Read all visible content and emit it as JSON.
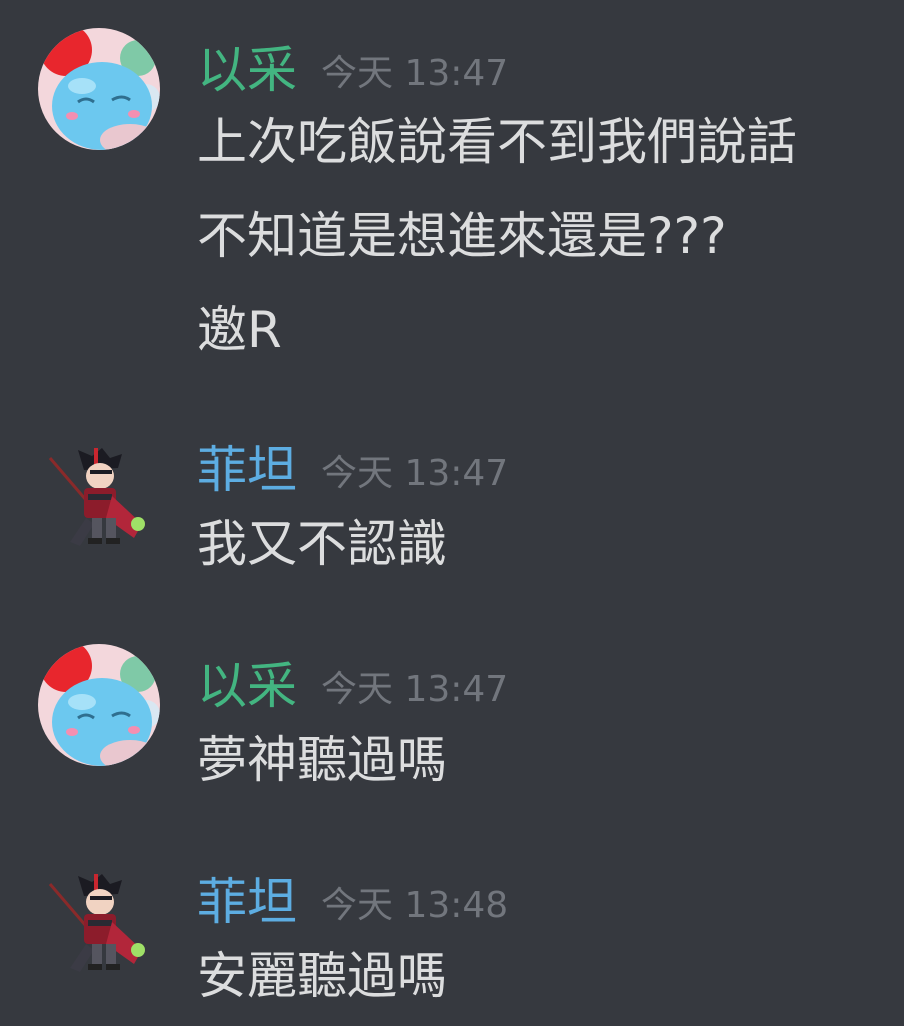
{
  "colors": {
    "background": "#36393f",
    "text": "#dcddde",
    "timestamp": "#72767d",
    "user_yicai": "#43b581",
    "user_feitan": "#5dade2"
  },
  "messages": [
    {
      "username": "以采",
      "timestamp": "今天 13:47",
      "avatar": "slime-avatar-icon",
      "lines": [
        "上次吃飯說看不到我們說話",
        "不知道是想進來還是???",
        "邀R"
      ]
    },
    {
      "username": "菲坦",
      "timestamp": "今天 13:47",
      "avatar": "warrior-sprite-avatar-icon",
      "lines": [
        "我又不認識"
      ]
    },
    {
      "username": "以采",
      "timestamp": "今天 13:47",
      "avatar": "slime-avatar-icon",
      "lines": [
        "夢神聽過嗎"
      ]
    },
    {
      "username": "菲坦",
      "timestamp": "今天 13:48",
      "avatar": "warrior-sprite-avatar-icon",
      "lines": [
        "安麗聽過嗎"
      ]
    }
  ]
}
